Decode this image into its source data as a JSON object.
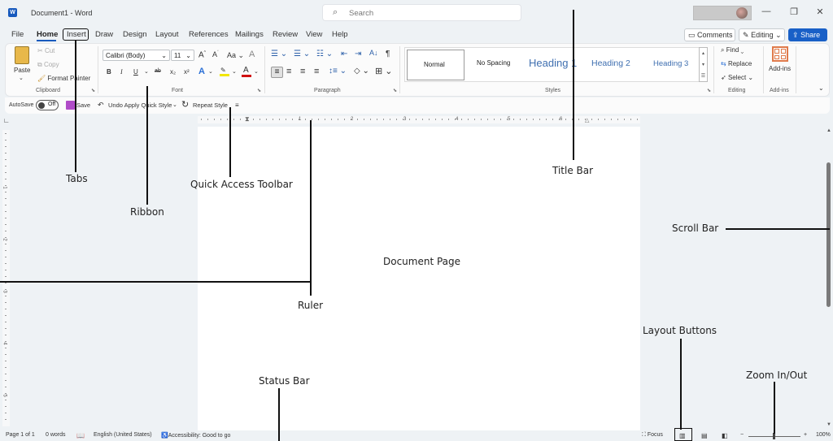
{
  "window": {
    "app_icon": "word-logo-icon",
    "title": "Document1 - Word",
    "search_placeholder": "Search",
    "controls": {
      "minimize": "—",
      "restore": "❐",
      "close": "✕"
    }
  },
  "tabs": [
    "File",
    "Home",
    "Insert",
    "Draw",
    "Design",
    "Layout",
    "References",
    "Mailings",
    "Review",
    "View",
    "Help"
  ],
  "active_tab": "Home",
  "header_buttons": {
    "comments": "Comments",
    "editing": "Editing",
    "share": "Share"
  },
  "ribbon": {
    "clipboard": {
      "paste": "Paste",
      "cut": "Cut",
      "copy": "Copy",
      "format_painter": "Format Painter",
      "label": "Clipboard"
    },
    "font": {
      "font_name": "Calibri (Body)",
      "font_size": "11",
      "grow": "A",
      "shrink": "A",
      "change_case": "Aa",
      "bold": "B",
      "italic": "I",
      "underline": "U",
      "strike": "ab",
      "subscript": "x₂",
      "superscript": "x²",
      "label": "Font"
    },
    "paragraph": {
      "label": "Paragraph",
      "pilcrow": "¶"
    },
    "styles": {
      "items": [
        "Normal",
        "No Spacing",
        "Heading 1",
        "Heading 2",
        "Heading 3"
      ],
      "label": "Styles"
    },
    "editing": {
      "find": "Find",
      "replace": "Replace",
      "select": "Select",
      "label": "Editing"
    },
    "addins": {
      "button": "Add-ins",
      "label": "Add-ins"
    }
  },
  "qat": {
    "autosave": "AutoSave",
    "autosave_state": "Off",
    "save": "Save",
    "undo": "Undo Apply Quick Style",
    "repeat": "Repeat Style"
  },
  "ruler": {
    "h_numbers": [
      "1",
      "2",
      "3",
      "4",
      "5",
      "6"
    ],
    "v_numbers": [
      "1",
      "2",
      "3",
      "4",
      "5"
    ]
  },
  "statusbar": {
    "page": "Page 1 of 1",
    "words": "0 words",
    "language": "English (United States)",
    "accessibility": "Accessibility: Good to go",
    "focus": "Focus",
    "zoom_level": "100%",
    "zoom_minus": "−",
    "zoom_plus": "+"
  },
  "annotations": {
    "tabs": "Tabs",
    "ribbon": "Ribbon",
    "qat": "Quick Access Toolbar",
    "title_bar": "Title Bar",
    "scroll_bar": "Scroll Bar",
    "document_page": "Document Page",
    "ruler": "Ruler",
    "layout_buttons": "Layout Buttons",
    "zoom": "Zoom In/Out",
    "status_bar": "Status Bar"
  },
  "colors": {
    "accent": "#185abd",
    "share": "#1960c7",
    "font_color_red": "#d01010",
    "highlight_yellow": "#f2e600"
  }
}
